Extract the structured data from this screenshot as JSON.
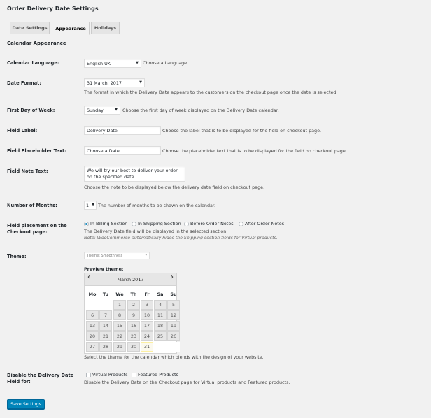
{
  "page_title": "Order Delivery Date Settings",
  "tabs": [
    {
      "label": "Date Settings",
      "active": false
    },
    {
      "label": "Appearance",
      "active": true
    },
    {
      "label": "Holidays",
      "active": false
    }
  ],
  "section_title": "Calendar Appearance",
  "fields": {
    "language": {
      "label": "Calendar Language:",
      "value": "English UK",
      "desc": "Choose a Language."
    },
    "date_format": {
      "label": "Date Format:",
      "value": "31 March, 2017",
      "desc": "The format in which the Delivery Date appears to the customers on the checkout page once the date is selected."
    },
    "first_day": {
      "label": "First Day of Week:",
      "value": "Sunday",
      "desc": "Choose the first day of week displayed on the Delivery Date calendar."
    },
    "field_label": {
      "label": "Field Label:",
      "value": "Delivery Date",
      "desc": "Choose the label that is to be displayed for the field on checkout page."
    },
    "placeholder": {
      "label": "Field Placeholder Text:",
      "value": "Choose a Date",
      "desc": "Choose the placeholder text that is to be displayed for the field on checkout page."
    },
    "note_text": {
      "label": "Field Note Text:",
      "value": "We will try our best to deliver your order on the specified date.",
      "desc": "Choose the note to be displayed below the delivery date field on checkout page."
    },
    "months": {
      "label": "Number of Months:",
      "value": "1",
      "desc": "The number of months to be shown on the calendar."
    },
    "placement": {
      "label": "Field placement on the Checkout page:",
      "options": [
        {
          "label": "In Billing Section",
          "checked": true
        },
        {
          "label": "In Shipping Section",
          "checked": false
        },
        {
          "label": "Before Order Notes",
          "checked": false
        },
        {
          "label": "After Order Notes",
          "checked": false
        }
      ],
      "desc": "The Delivery Date field will be displayed in the selected section.",
      "note": "Note: WooCommerce automatically hides the Shipping section fields for Virtual products."
    },
    "theme": {
      "label": "Theme:",
      "value": "Theme: Smoothness",
      "preview_label": "Preview theme:",
      "desc": "Select the theme for the calendar which blends with the design of your website."
    },
    "disable": {
      "label": "Disable the Delivery Date Field for:",
      "options": [
        {
          "label": "Virtual Products",
          "checked": false
        },
        {
          "label": "Featured Products",
          "checked": false
        }
      ],
      "desc": "Disable the Delivery Date on the Checkout page for Virtual products and Featured products."
    }
  },
  "calendar": {
    "month_label": "March 2017",
    "prev_glyph": "‹",
    "next_glyph": "›",
    "weekdays": [
      "Mo",
      "Tu",
      "We",
      "Th",
      "Fr",
      "Sa",
      "Su"
    ],
    "weeks": [
      [
        "",
        "",
        "1",
        "2",
        "3",
        "4",
        "5"
      ],
      [
        "6",
        "7",
        "8",
        "9",
        "10",
        "11",
        "12"
      ],
      [
        "13",
        "14",
        "15",
        "16",
        "17",
        "18",
        "19"
      ],
      [
        "20",
        "21",
        "22",
        "23",
        "24",
        "25",
        "26"
      ],
      [
        "27",
        "28",
        "29",
        "30",
        "31",
        "",
        ""
      ]
    ],
    "today": "31"
  },
  "save_label": "Save Settings",
  "colors": {
    "primary": "#0085ba",
    "background": "#f1f1f1"
  }
}
